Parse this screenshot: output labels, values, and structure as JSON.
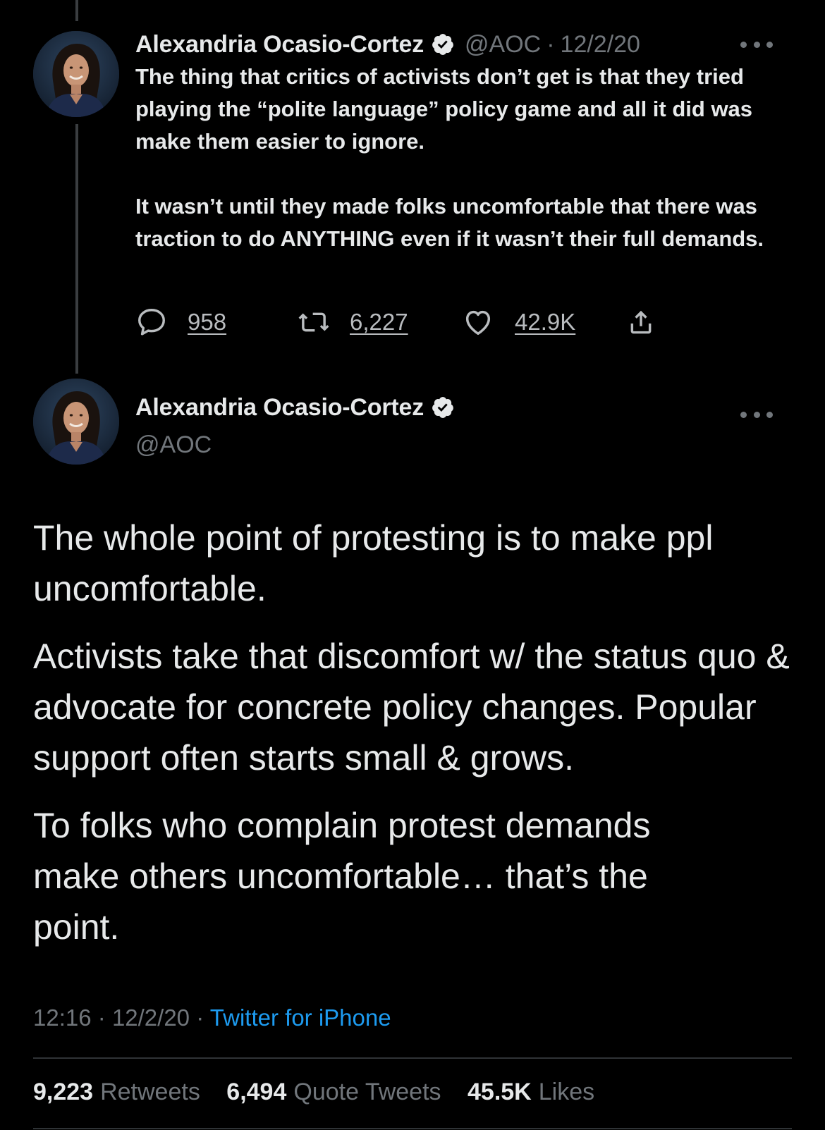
{
  "parent_tweet": {
    "display_name": "Alexandria Ocasio-Cortez",
    "handle": "@AOC",
    "separator": "·",
    "date": "12/2/20",
    "paragraphs": [
      "The thing that critics of activists don’t get is that they tried playing the “polite language” policy game and all it did was make them easier to ignore.",
      "It wasn’t until they made folks uncomfortable that there was traction to do ANYTHING even if it wasn’t their full demands."
    ],
    "actions": {
      "replies": "958",
      "retweets": "6,227",
      "likes": "42.9K"
    }
  },
  "main_tweet": {
    "display_name": "Alexandria Ocasio-Cortez",
    "handle": "@AOC",
    "paragraphs": [
      "The whole point of protesting is to make ppl uncomfortable.",
      "Activists take that discomfort w/ the status quo & advocate for concrete policy changes. Popular support often starts small & grows.",
      "To folks who complain protest demands make others uncomfortable… that’s the point."
    ],
    "time": "12:16",
    "separator": "·",
    "date": "12/2/20",
    "source": "Twitter for iPhone",
    "stats": {
      "retweets_count": "9,223",
      "retweets_label": "Retweets",
      "quotes_count": "6,494",
      "quotes_label": "Quote Tweets",
      "likes_count": "45.5K",
      "likes_label": "Likes"
    }
  },
  "colors": {
    "background": "#000000",
    "text_primary": "#e7e9ea",
    "text_secondary": "#71767b",
    "link": "#1d9bf0",
    "divider": "#2f3336"
  },
  "icons": [
    "verified-badge-icon",
    "more-options-icon",
    "reply-icon",
    "retweet-icon",
    "like-icon",
    "share-icon"
  ]
}
